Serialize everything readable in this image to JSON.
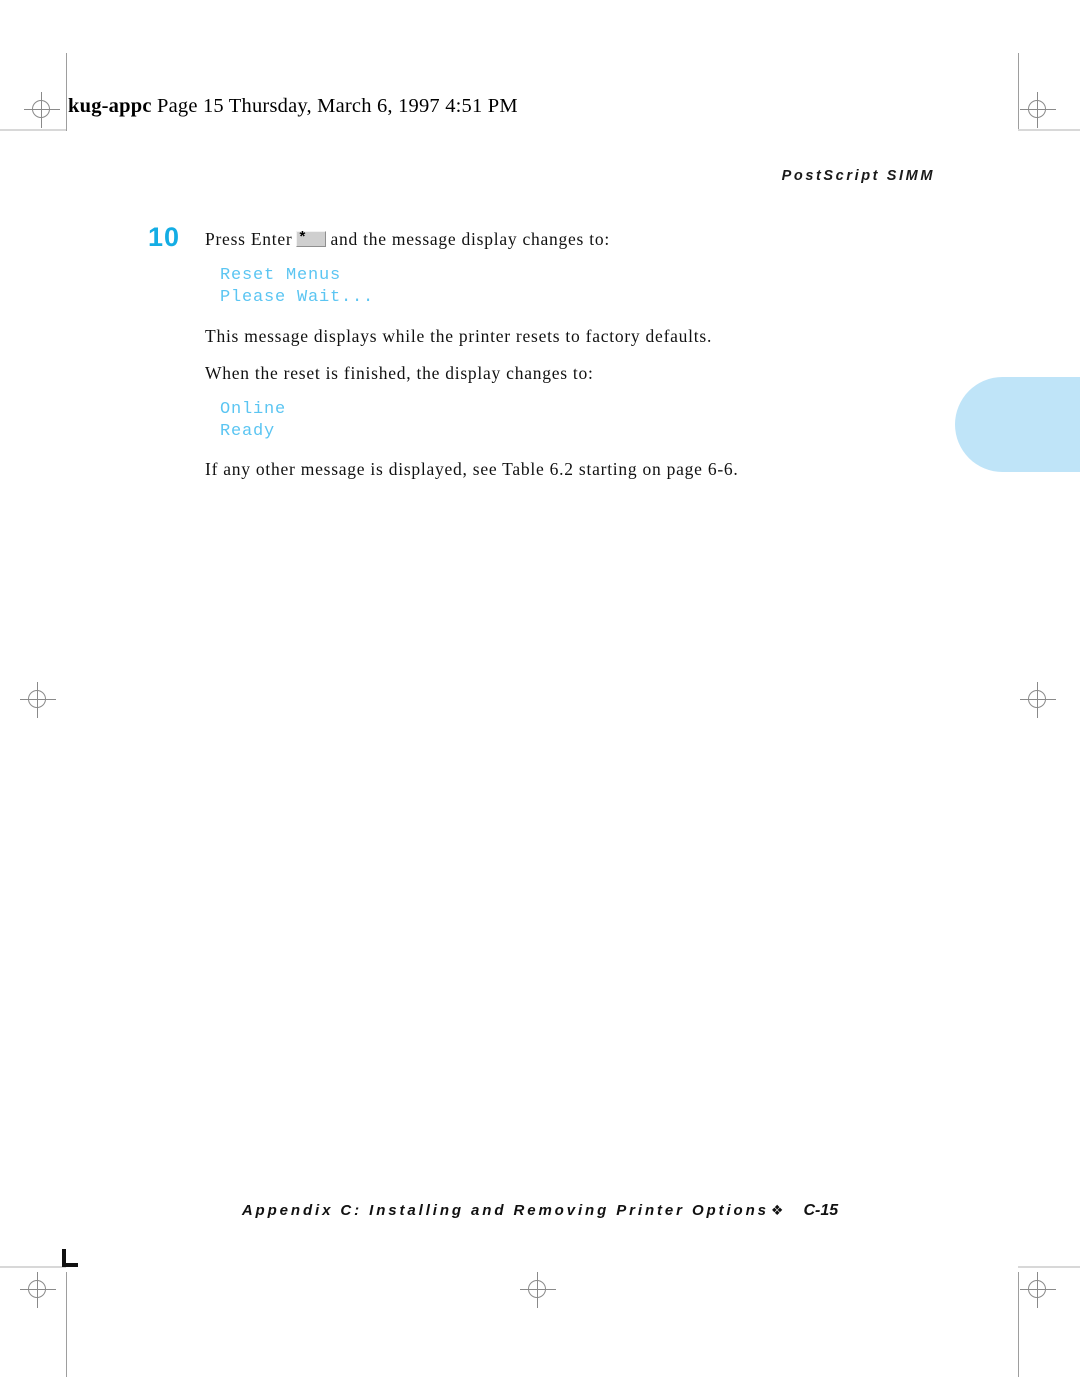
{
  "page": {
    "file_header": {
      "filename": "kug-appc",
      "rest": "  Page 15  Thursday, March 6, 1997  4:51 PM"
    },
    "running_head": "PostScript SIMM"
  },
  "content": {
    "step": {
      "number": "10",
      "text_before_key": "Press Enter",
      "key_glyph": "*",
      "text_after_key": "and the message display changes to:"
    },
    "lcd_first": {
      "line1": "Reset Menus",
      "line2": "Please Wait..."
    },
    "para_reset": "This message displays while the printer resets to factory defaults.",
    "para_finished": "When the reset is finished, the display changes to:",
    "lcd_second": {
      "line1": "Online",
      "line2": "Ready"
    },
    "para_other": "If any other message is displayed, see Table 6.2 starting on page 6-6."
  },
  "footer": {
    "title": "Appendix C: Installing and Removing Printer Options",
    "diamond": "❖",
    "page_number": "C-15"
  },
  "colors": {
    "step_number": "#14ade4",
    "lcd_text": "#5bc5f2",
    "thumb_tab": "#bfe4f8",
    "key_cap": "#cfcfcf"
  }
}
